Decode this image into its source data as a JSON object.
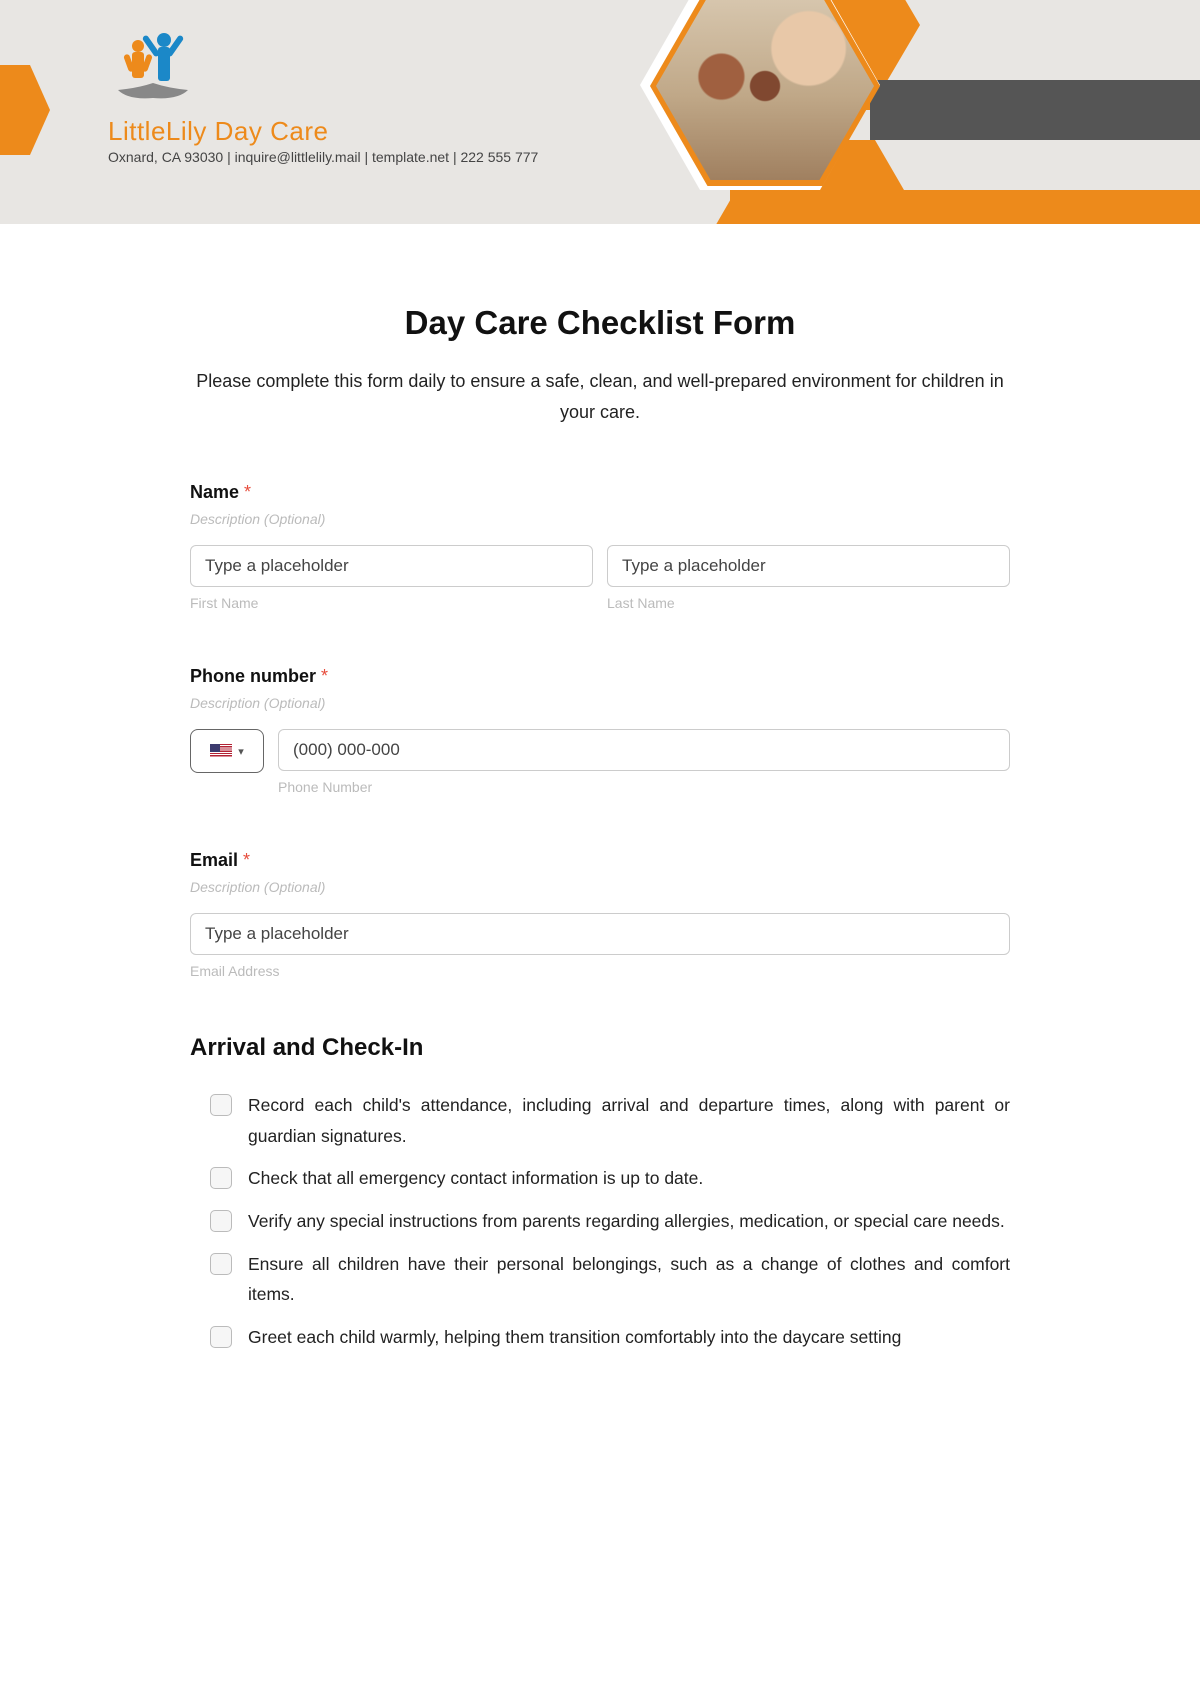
{
  "header": {
    "brand_name": "LittleLily Day Care",
    "contact_line": "Oxnard, CA 93030 | inquire@littlelily.mail | template.net | 222 555 777"
  },
  "form": {
    "title": "Day Care Checklist Form",
    "intro": "Please complete this form daily to ensure a safe, clean, and well-prepared environment for children in your care."
  },
  "name_field": {
    "label": "Name",
    "required_mark": "*",
    "desc": "Description (Optional)",
    "first_placeholder": "Type a placeholder",
    "last_placeholder": "Type a placeholder",
    "first_sub": "First Name",
    "last_sub": "Last Name"
  },
  "phone_field": {
    "label": "Phone number",
    "required_mark": "*",
    "desc": "Description (Optional)",
    "placeholder": "(000) 000-000",
    "sub": "Phone Number"
  },
  "email_field": {
    "label": "Email",
    "required_mark": "*",
    "desc": "Description (Optional)",
    "placeholder": "Type a placeholder",
    "sub": "Email Address"
  },
  "section1": {
    "heading": "Arrival and Check-In",
    "items": [
      "Record each child's attendance, including arrival and departure times, along with parent or guardian signatures.",
      "Check that all emergency contact information is up to date.",
      "Verify any special instructions from parents regarding allergies, medication, or special care needs.",
      "Ensure all children have their personal belongings, such as a change of clothes and comfort items.",
      "Greet each child warmly, helping them transition comfortably into the daycare setting"
    ]
  }
}
